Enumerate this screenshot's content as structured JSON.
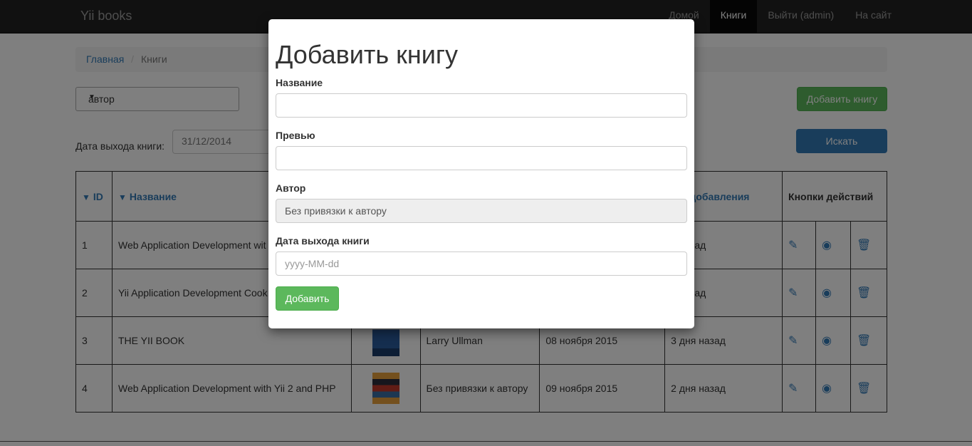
{
  "navbar": {
    "brand": "Yii books",
    "links": [
      "Домой",
      "Книги",
      "Выйти (admin)",
      "На сайт"
    ]
  },
  "breadcrumb": {
    "home": "Главная",
    "separator": "/",
    "current": "Книги"
  },
  "filter": {
    "author_select": "автор",
    "add_book_button": "Добавить книгу",
    "date_label": "Дата выхода книги:",
    "date_value": "31/12/2014",
    "search_button": "Искать"
  },
  "table": {
    "headers": {
      "id": "ID",
      "name": "Название",
      "date_added": "ата добавления",
      "actions": "Кнопки действий"
    },
    "rows": [
      {
        "id": "1",
        "name": "Web Application Development wit",
        "author": "",
        "date": "",
        "added": "я назад"
      },
      {
        "id": "2",
        "name": "Yii Application Development Cook",
        "author": "",
        "date": "",
        "added": "я назад"
      },
      {
        "id": "3",
        "name": "THE YII BOOK",
        "author": "Larry Ullman",
        "date": "08 ноября 2015",
        "added": "3 дня назад"
      },
      {
        "id": "4",
        "name": "Web Application Development with Yii 2 and PHP",
        "author": "Без привязки к автору",
        "date": "09 ноября 2015",
        "added": "2 дня назад"
      }
    ]
  },
  "modal": {
    "title": "Добавить книгу",
    "name_label": "Название",
    "preview_label": "Превью",
    "author_label": "Автор",
    "author_value": "Без привязки к автору",
    "date_label": "Дата выхода книги",
    "date_placeholder": "yyyy-MM-dd",
    "submit": "Добавить"
  },
  "colors": {
    "accent": "#337ab7",
    "success": "#5cb85c",
    "navbar": "#222222"
  }
}
